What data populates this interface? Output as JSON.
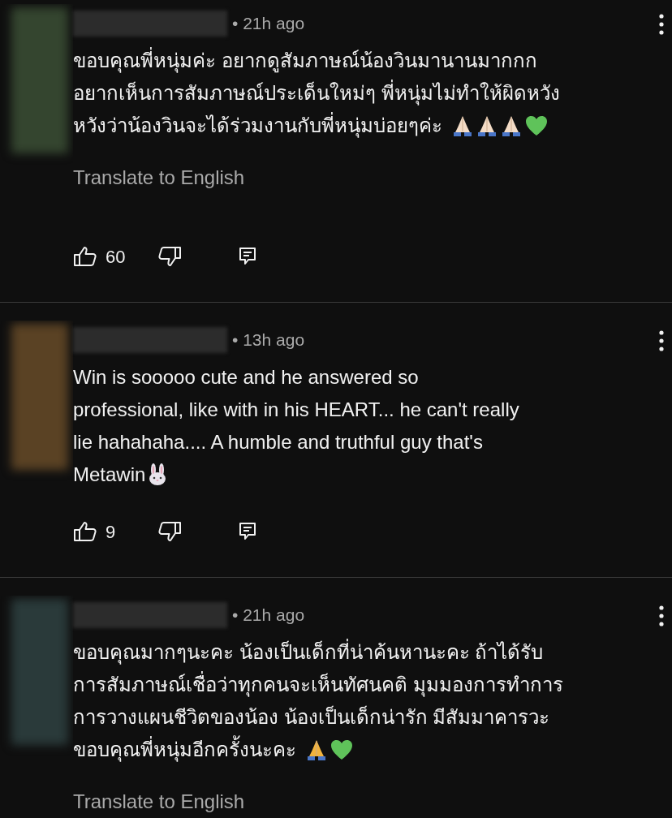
{
  "comments": [
    {
      "color": "#34452f",
      "time": "• 21h ago",
      "lines": [
        "ขอบคุณพี่หนุ่มค่ะ อยากดูสัมภาษณ์น้องวินมานานมากกก",
        "อยากเห็นการสัมภาษณ์ประเด็นใหม่ๆ พี่หนุ่มไม่ทำให้ผิดหวัง",
        "หวังว่าน้องวินจะได้ร่วมงานกับพี่หนุ่มบ่อยๆค่ะ"
      ],
      "emoji": [
        {
          "kind": "praylight"
        },
        {
          "kind": "praylight"
        },
        {
          "kind": "praylight"
        },
        {
          "kind": "heart"
        }
      ],
      "translate": "Translate to English",
      "likes": "60"
    },
    {
      "color": "#5a4224",
      "time": "• 13h ago",
      "lines": [
        "Win is sooooo cute and he answered so",
        "professional, like with in his HEART... he can't really",
        "lie hahahaha.... A humble and truthful guy that's",
        "Metawin"
      ],
      "emoji": [
        {
          "kind": "rabbit"
        }
      ],
      "likes": "9"
    },
    {
      "color": "#2a3a3a",
      "time": "• 21h ago",
      "lines": [
        "ขอบคุณมากๆนะคะ น้องเป็นเด็กที่น่าค้นหานะคะ  ถ้าได้รับ",
        "การสัมภาษณ์เชื่อว่าทุกคนจะเห็นทัศนคติ มุมมองการทำการ",
        "การวางแผนชีวิตของน้อง น้องเป็นเด็กน่ารัก มีสัมมาคารวะ",
        "ขอบคุณพี่หนุ่มอีกครั้งนะคะ"
      ],
      "emoji": [
        {
          "kind": "pray"
        },
        {
          "kind": "heart"
        }
      ],
      "translate": "Translate to English"
    }
  ]
}
